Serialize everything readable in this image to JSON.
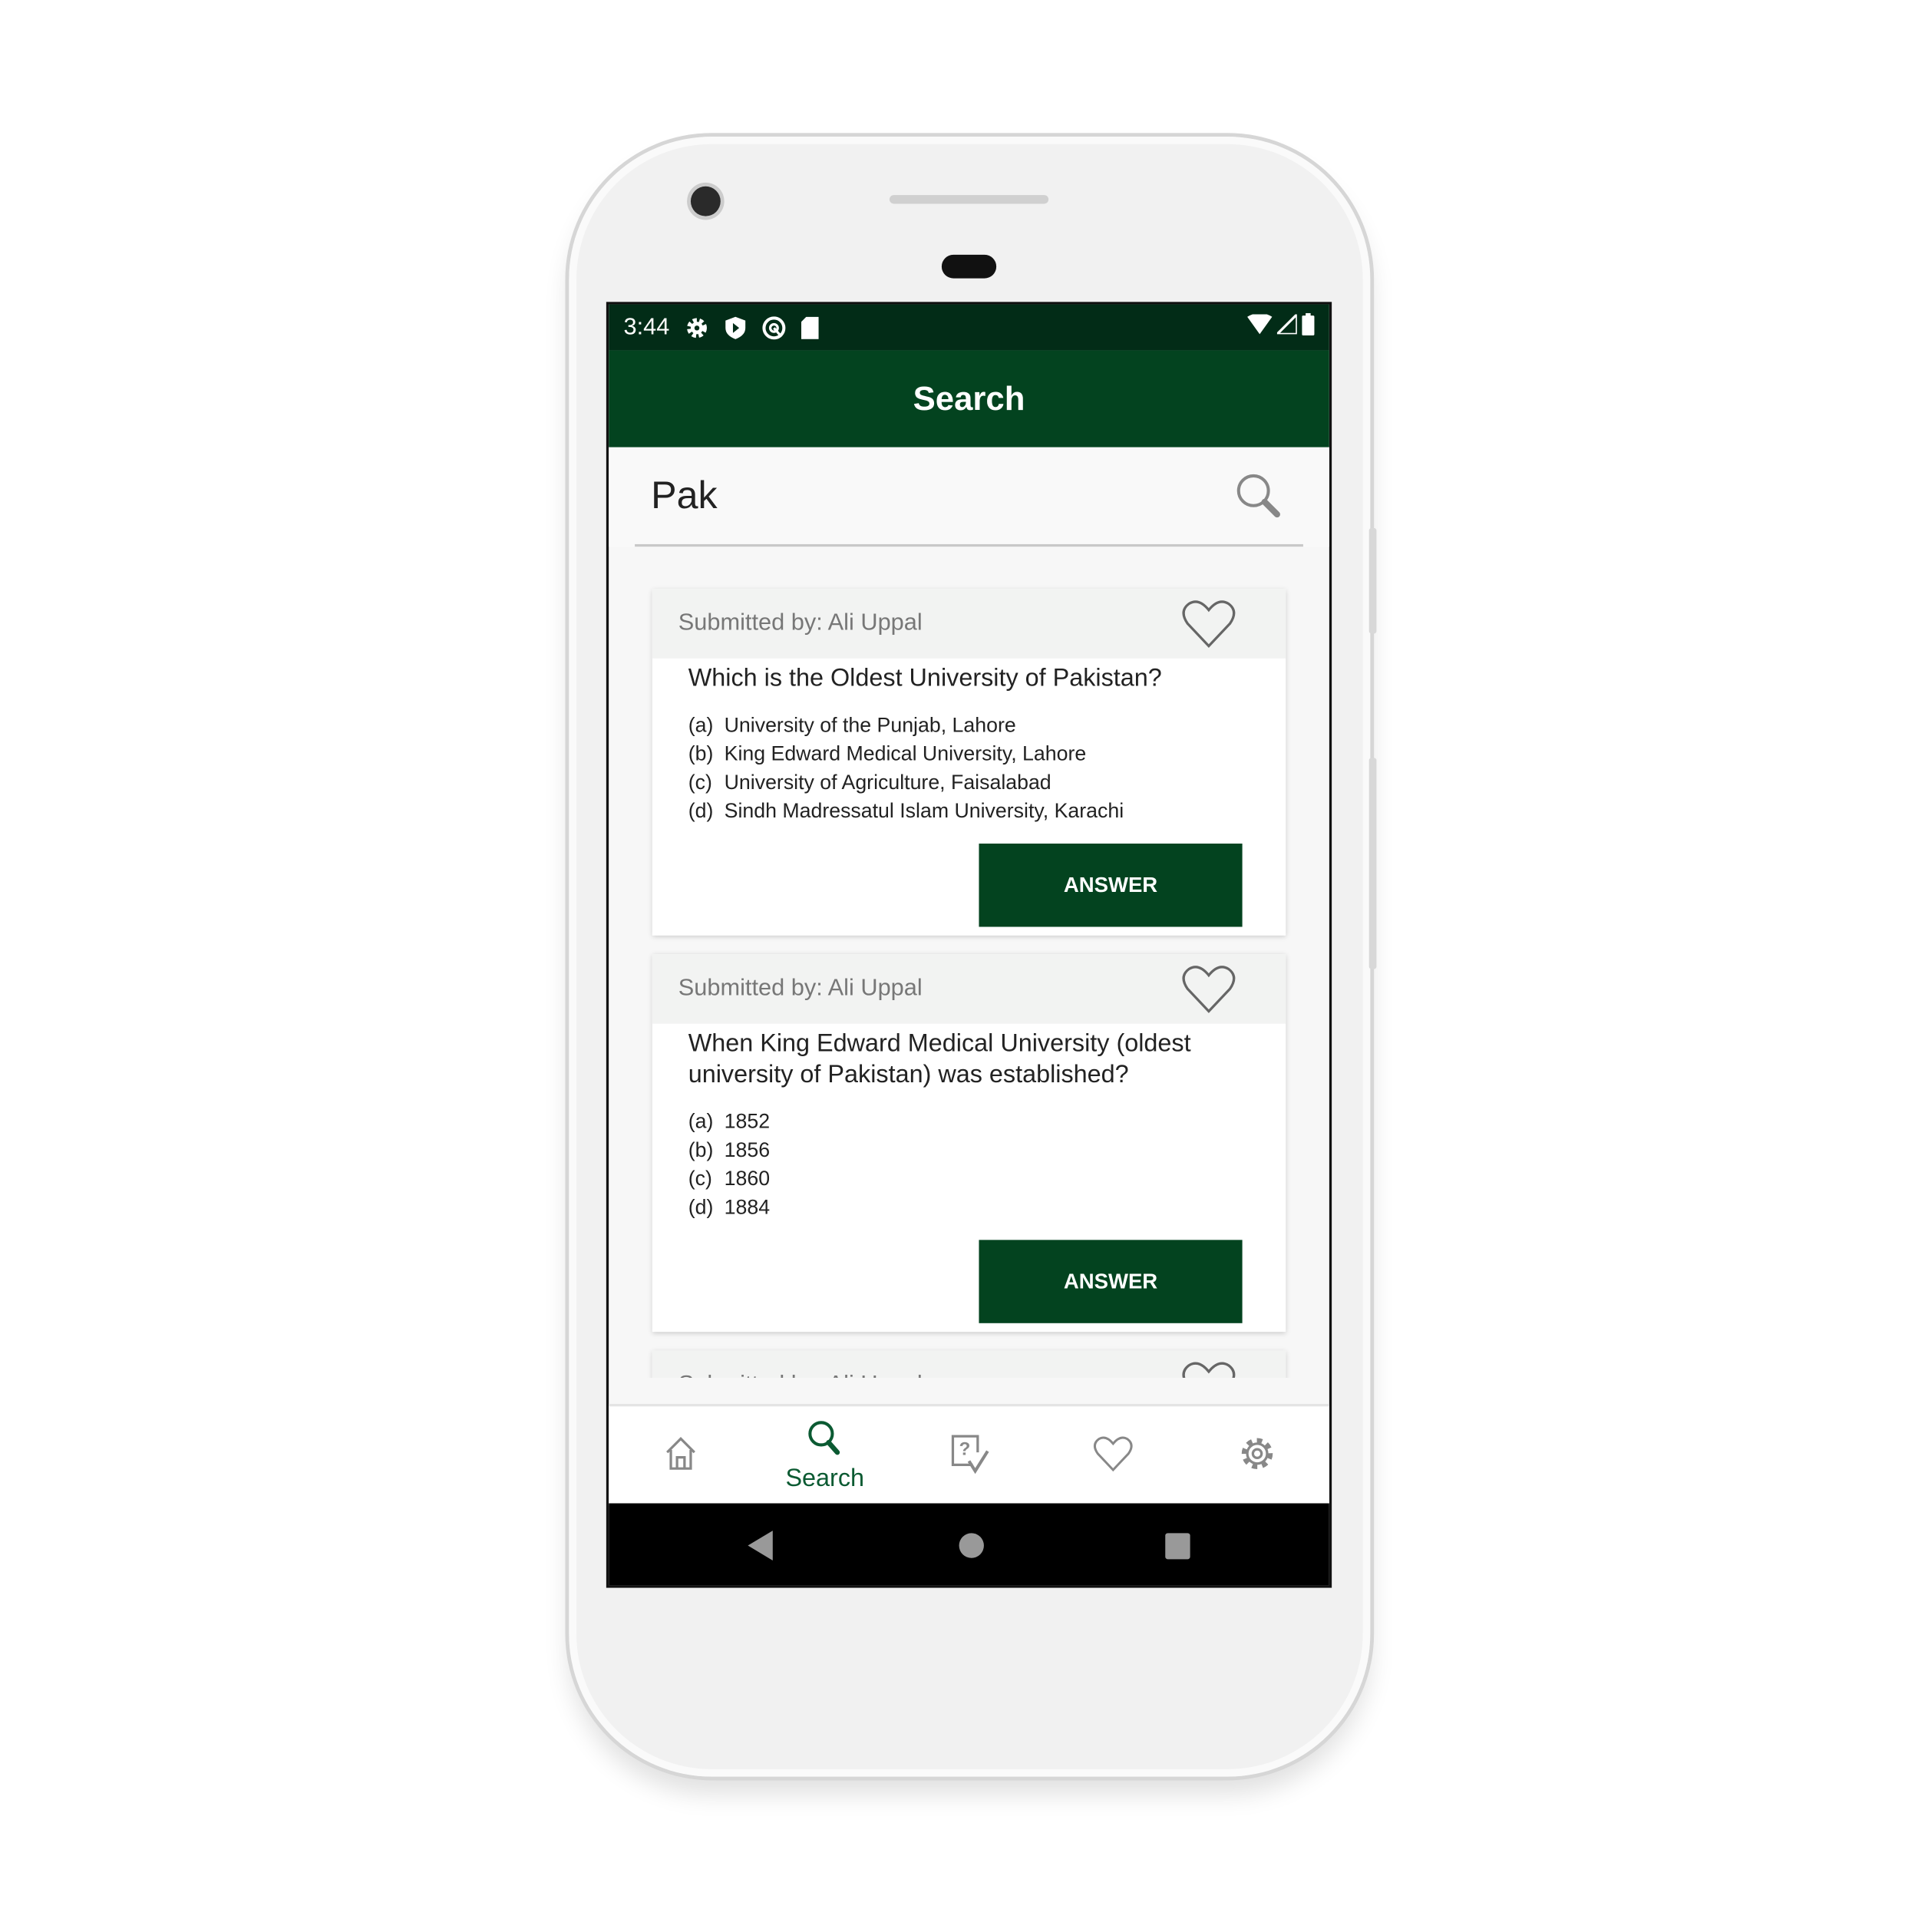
{
  "status_bar": {
    "time": "3:44",
    "left_icons": [
      "gear-icon",
      "shield-play-icon",
      "at-sign-icon",
      "sd-card-icon"
    ],
    "right_icons": [
      "wifi-icon",
      "signal-icon",
      "battery-icon"
    ]
  },
  "app_bar": {
    "title": "Search"
  },
  "search": {
    "value": "Pak",
    "icon": "search-icon"
  },
  "cards": [
    {
      "submitted_by": "Submitted by: Ali Uppal",
      "question": "Which is the Oldest University of Pakistan?",
      "options": [
        {
          "label": "(a)",
          "text": "University of the Punjab, Lahore"
        },
        {
          "label": "(b)",
          "text": "King Edward Medical University, Lahore"
        },
        {
          "label": "(c)",
          "text": "University of Agriculture, Faisalabad"
        },
        {
          "label": "(d)",
          "text": "Sindh Madressatul Islam University, Karachi"
        }
      ],
      "answer_label": "ANSWER"
    },
    {
      "submitted_by": "Submitted by: Ali Uppal",
      "question": "When King Edward Medical University (oldest university of Pakistan) was established?",
      "options": [
        {
          "label": "(a)",
          "text": "1852"
        },
        {
          "label": "(b)",
          "text": "1856"
        },
        {
          "label": "(c)",
          "text": "1860"
        },
        {
          "label": "(d)",
          "text": "1884"
        }
      ],
      "answer_label": "ANSWER"
    },
    {
      "submitted_by": "Submitted by: Ali Uppal",
      "question": "",
      "options": [],
      "answer_label": ""
    }
  ],
  "bottom_nav": {
    "items": [
      {
        "icon": "home-icon",
        "label": ""
      },
      {
        "icon": "search-icon",
        "label": "Search",
        "active": true
      },
      {
        "icon": "quiz-check-icon",
        "label": ""
      },
      {
        "icon": "heart-icon",
        "label": ""
      },
      {
        "icon": "gear-icon",
        "label": ""
      }
    ]
  },
  "colors": {
    "primary": "#03431f",
    "status_bar": "#022c17",
    "active_nav": "#0b5a32"
  }
}
